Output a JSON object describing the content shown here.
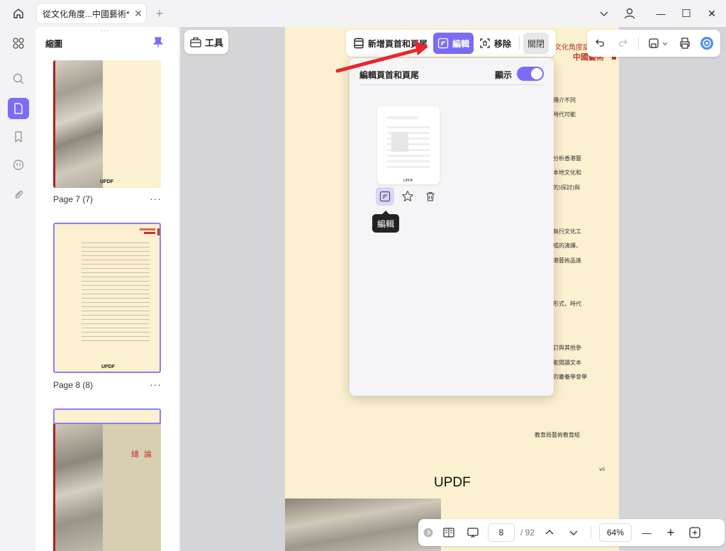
{
  "tab": {
    "title": "從文化角度...中國藝術*",
    "close": "✕",
    "new": "+"
  },
  "window": {
    "minimize": "—",
    "maximize": "☐",
    "close": "✕"
  },
  "thumbnails": {
    "title": "縮圖",
    "pages": [
      {
        "label": "Page 7 (7)",
        "footer": "UPDF"
      },
      {
        "label": "Page 8 (8)",
        "footer": "UPDF"
      },
      {
        "label": "",
        "heading": "總 論"
      }
    ],
    "more": "···"
  },
  "toolbar": {
    "tools": "工具",
    "add_header_footer": "新增頁首和頁尾",
    "edit": "編輯",
    "remove": "移除",
    "close": "關閉"
  },
  "popup": {
    "title": "編輯頁首和頁尾",
    "show_label": "顯示",
    "show_enabled": true,
    "template_footer": "UPDF",
    "tooltip": "編輯"
  },
  "document": {
    "header_title": "文化角度認",
    "header_sub": "中國藝術",
    "lines": [
      "傳介不同",
      "時代可能",
      "分析香港藝",
      "本地文化和",
      "的)探討)與",
      "執行文化工",
      "成的演繹，",
      "港藝術品進",
      "形式，時代",
      "訂與其他參",
      "能閱讀文本",
      "的審養學會學"
    ],
    "signature": "教育局藝術教育組",
    "page_number": "vii",
    "footer": "UPDF"
  },
  "bottom": {
    "page_current": "8",
    "page_total": "/ 92",
    "zoom": "64%",
    "zoom_out": "—",
    "zoom_in": "+"
  },
  "colors": {
    "accent": "#7b6cf6",
    "page": "#fbf0cf",
    "arrow": "#e8262b",
    "doc_red": "#c0392b"
  }
}
